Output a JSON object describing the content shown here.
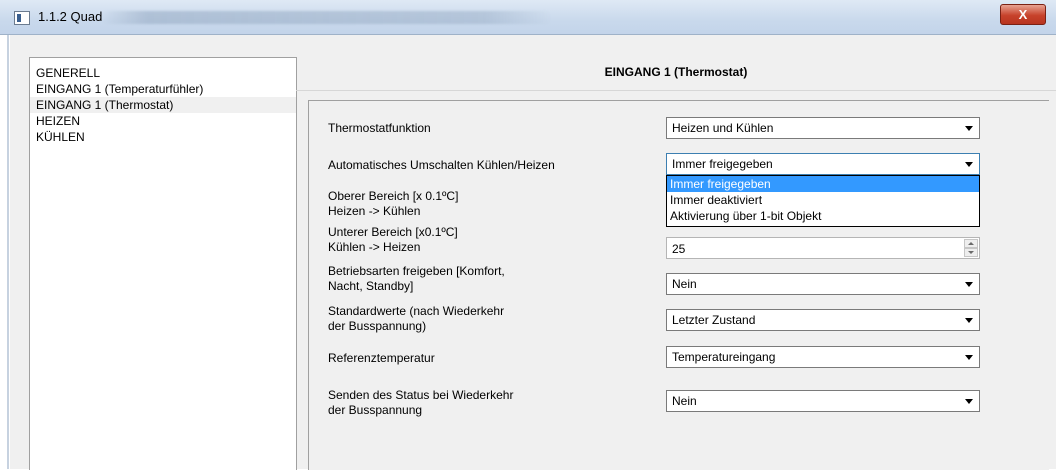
{
  "window": {
    "title": "1.1.2 Quad",
    "close_label": "X"
  },
  "nav": {
    "items": [
      {
        "label": "GENERELL"
      },
      {
        "label": "EINGANG 1 (Temperaturfühler)"
      },
      {
        "label": "EINGANG 1 (Thermostat)"
      },
      {
        "label": "HEIZEN"
      },
      {
        "label": "KÜHLEN"
      }
    ]
  },
  "main": {
    "section_title": "EINGANG 1 (Thermostat)",
    "rows": [
      {
        "label_line1": "Thermostatfunktion",
        "label_line2": "",
        "value": "Heizen und Kühlen"
      },
      {
        "label_line1": "Automatisches Umschalten Kühlen/Heizen",
        "label_line2": "",
        "value": "Immer freigegeben"
      },
      {
        "label_line1": "Oberer Bereich [x 0.1ºC]",
        "label_line2": "Heizen -> Kühlen",
        "value": ""
      },
      {
        "label_line1": "Unterer Bereich [x0.1ºC]",
        "label_line2": "Kühlen -> Heizen",
        "value": "25"
      },
      {
        "label_line1": "Betriebsarten freigeben [Komfort,",
        "label_line2": "Nacht, Standby]",
        "value": "Nein"
      },
      {
        "label_line1": "Standardwerte (nach Wiederkehr",
        "label_line2": "der Busspannung)",
        "value": "Letzter Zustand"
      },
      {
        "label_line1": "Referenztemperatur",
        "label_line2": "",
        "value": "Temperatureingang"
      },
      {
        "label_line1": "Senden des Status bei Wiederkehr",
        "label_line2": "der Busspannung",
        "value": "Nein"
      }
    ],
    "dropdown_options": [
      "Immer freigegeben",
      "Immer deaktiviert",
      "Aktivierung über 1-bit Objekt"
    ]
  }
}
